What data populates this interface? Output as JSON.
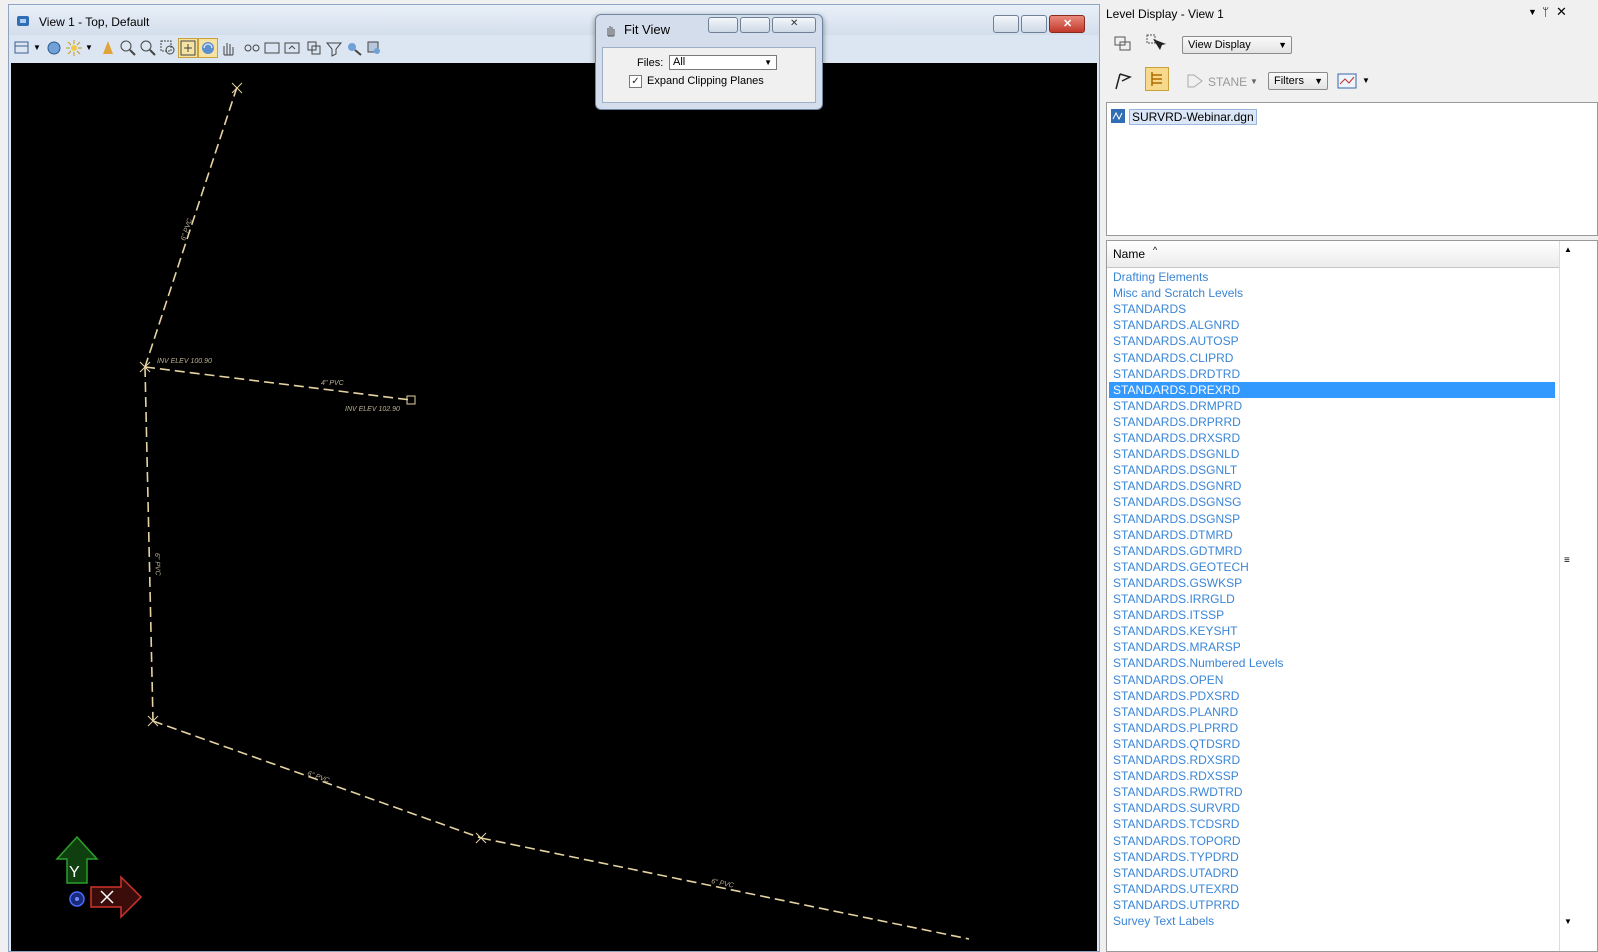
{
  "view_window": {
    "title": "View 1 - Top, Default"
  },
  "fit_view_dialog": {
    "title": "Fit View",
    "files_label": "Files:",
    "files_value": "All",
    "expand_label": "Expand Clipping Planes",
    "expand_checked": true
  },
  "canvas": {
    "annotations": [
      "INV ELEV 100.90",
      "4\" PVC",
      "INV ELEV 102.90",
      "6\" PVC",
      "6\" PVC",
      "6\" PVC",
      "6\" PVC"
    ],
    "axis_y_label": "Y"
  },
  "level_panel": {
    "title": "Level Display - View 1",
    "display_mode": "View Display",
    "filter_label": "STANE",
    "filters_label": "Filters",
    "file_name": "SURVRD-Webinar.dgn",
    "column_header": "Name",
    "selected_index": 7,
    "levels": [
      "Drafting Elements",
      "Misc and Scratch Levels",
      "STANDARDS",
      "STANDARDS.ALGNRD",
      "STANDARDS.AUTOSP",
      "STANDARDS.CLIPRD",
      "STANDARDS.DRDTRD",
      "STANDARDS.DREXRD",
      "STANDARDS.DRMPRD",
      "STANDARDS.DRPRRD",
      "STANDARDS.DRXSRD",
      "STANDARDS.DSGNLD",
      "STANDARDS.DSGNLT",
      "STANDARDS.DSGNRD",
      "STANDARDS.DSGNSG",
      "STANDARDS.DSGNSP",
      "STANDARDS.DTMRD",
      "STANDARDS.GDTMRD",
      "STANDARDS.GEOTECH",
      "STANDARDS.GSWKSP",
      "STANDARDS.IRRGLD",
      "STANDARDS.ITSSP",
      "STANDARDS.KEYSHT",
      "STANDARDS.MRARSP",
      "STANDARDS.Numbered Levels",
      "STANDARDS.OPEN",
      "STANDARDS.PDXSRD",
      "STANDARDS.PLANRD",
      "STANDARDS.PLPRRD",
      "STANDARDS.QTDSRD",
      "STANDARDS.RDXSRD",
      "STANDARDS.RDXSSP",
      "STANDARDS.RWDTRD",
      "STANDARDS.SURVRD",
      "STANDARDS.TCDSRD",
      "STANDARDS.TOPORD",
      "STANDARDS.TYPDRD",
      "STANDARDS.UTADRD",
      "STANDARDS.UTEXRD",
      "STANDARDS.UTPRRD",
      "Survey Text Labels"
    ]
  },
  "colors": {
    "canvas_bg": "#000000",
    "linework": "#e6d3a3",
    "level_text": "#3a86d6",
    "selection": "#3399ff",
    "axis_y": "#1e7a1e",
    "axis_x": "#c0302b"
  }
}
